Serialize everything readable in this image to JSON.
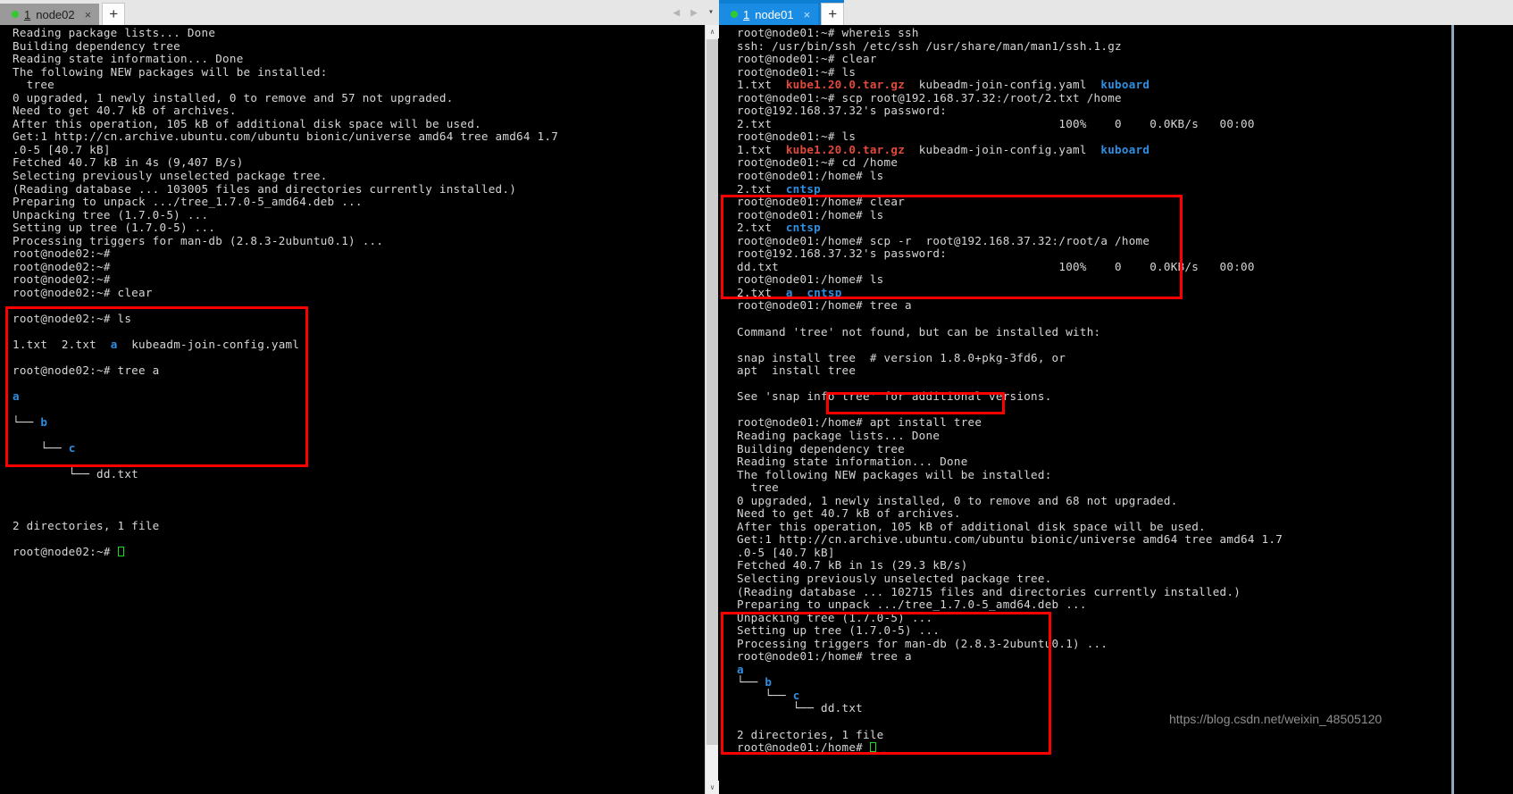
{
  "watermark": "https://blog.csdn.net/weixin_48505120",
  "left_window": {
    "tab": {
      "number": "1",
      "title": "node02",
      "close": "×",
      "status_dot": "green-dot-icon"
    },
    "new_tab_label": "+",
    "nav": {
      "back": "◀",
      "forward": "▶",
      "menu": "▾"
    },
    "terminal_lines": [
      "Reading package lists... Done",
      "Building dependency tree",
      "Reading state information... Done",
      "The following NEW packages will be installed:",
      "  tree",
      "0 upgraded, 1 newly installed, 0 to remove and 57 not upgraded.",
      "Need to get 40.7 kB of archives.",
      "After this operation, 105 kB of additional disk space will be used.",
      "Get:1 http://cn.archive.ubuntu.com/ubuntu bionic/universe amd64 tree amd64 1.7",
      ".0-5 [40.7 kB]",
      "Fetched 40.7 kB in 4s (9,407 B/s)",
      "Selecting previously unselected package tree.",
      "(Reading database ... 103005 files and directories currently installed.)",
      "Preparing to unpack .../tree_1.7.0-5_amd64.deb ...",
      "Unpacking tree (1.7.0-5) ...",
      "Setting up tree (1.7.0-5) ...",
      "Processing triggers for man-db (2.8.3-2ubuntu0.1) ...",
      "root@node02:~#",
      "root@node02:~#",
      "root@node02:~#",
      "root@node02:~# clear"
    ],
    "boxed_lines": {
      "cmd_ls": "root@node02:~# ls",
      "ls_out_1": "1.txt  2.txt  ",
      "ls_out_dir": "a",
      "ls_out_2": "  kubeadm-join-config.yaml",
      "cmd_tree": "root@node02:~# tree a",
      "tree_a": "a",
      "tree_b_branch": "└── ",
      "tree_b": "b",
      "tree_c_branch": "    └── ",
      "tree_c": "c",
      "tree_file_branch": "        └── dd.txt",
      "tree_blank": "",
      "tree_summary": "2 directories, 1 file",
      "prompt_final": "root@node02:~# "
    }
  },
  "right_window": {
    "tab": {
      "number": "1",
      "title": "node01",
      "close": "×",
      "status_dot": "green-dot-icon"
    },
    "new_tab_label": "+",
    "scroll": {
      "up": "∧",
      "down": "∨"
    },
    "segment_1": [
      "root@node01:~# whereis ssh",
      "ssh: /usr/bin/ssh /etc/ssh /usr/share/man/man1/ssh.1.gz",
      "root@node01:~# clear",
      "root@node01:~# ls"
    ],
    "ls_line_1": {
      "plain_a": "1.txt  ",
      "archive": "kube1.20.0.tar.gz",
      "plain_b": "  kubeadm-join-config.yaml  ",
      "dir": "kuboard"
    },
    "segment_2": [
      "root@node01:~# scp root@192.168.37.32:/root/2.txt /home",
      "root@192.168.37.32's password:",
      "2.txt                                         100%    0    0.0KB/s   00:00",
      "root@node01:~# ls"
    ],
    "ls_line_2": {
      "plain_a": "1.txt  ",
      "archive": "kube1.20.0.tar.gz",
      "plain_b": "  kubeadm-join-config.yaml  ",
      "dir": "kuboard"
    },
    "segment_3": [
      "root@node01:~# cd /home",
      "root@node01:/home# ls"
    ],
    "ls_line_3": {
      "plain_a": "2.txt  ",
      "dir": "cntsp"
    },
    "segment_4": [
      "root@node01:/home# clear"
    ],
    "boxed_block_1": {
      "cmd_ls": "root@node01:/home# ls",
      "ls_plain": "2.txt  ",
      "ls_dir": "cntsp",
      "cmd_scp": "root@node01:/home# scp -r  root@192.168.37.32:/root/a /home",
      "password": "root@192.168.37.32's password:",
      "transfer": "dd.txt                                        100%    0    0.0KB/s   00:00",
      "cmd_ls2": "root@node01:/home# ls",
      "ls2_plain_a": "2.txt  ",
      "ls2_dir_a": "a",
      "ls2_plain_b": "  ",
      "ls2_dir_b": "cntsp",
      "cmd_tree": "root@node01:/home# tree a"
    },
    "tree_not_found": [
      "",
      "Command 'tree' not found, but can be installed with:",
      "",
      "snap install tree  # version 1.8.0+pkg-3fd6, or",
      "apt  install tree",
      "",
      "See 'snap info tree' for additional versions.",
      ""
    ],
    "apt_prompt": {
      "prompt": "root@node01:/home# ",
      "command": "apt install tree"
    },
    "apt_output": [
      "Reading package lists... Done",
      "Building dependency tree",
      "Reading state information... Done",
      "The following NEW packages will be installed:",
      "  tree",
      "0 upgraded, 1 newly installed, 0 to remove and 68 not upgraded.",
      "Need to get 40.7 kB of archives.",
      "After this operation, 105 kB of additional disk space will be used.",
      "Get:1 http://cn.archive.ubuntu.com/ubuntu bionic/universe amd64 tree amd64 1.7",
      ".0-5 [40.7 kB]",
      "Fetched 40.7 kB in 1s (29.3 kB/s)",
      "Selecting previously unselected package tree.",
      "(Reading database ... 102715 files and directories currently installed.)",
      "Preparing to unpack .../tree_1.7.0-5_amd64.deb ...",
      "Unpacking tree (1.7.0-5) ...",
      "Setting up tree (1.7.0-5) ...",
      "Processing triggers for man-db (2.8.3-2ubuntu0.1) ..."
    ],
    "boxed_block_2": {
      "cmd_tree": "root@node01:/home# tree a",
      "tree_a": "a",
      "tree_b_branch": "└── ",
      "tree_b": "b",
      "tree_c_branch": "    └── ",
      "tree_c": "c",
      "tree_file_branch": "        └── dd.txt",
      "tree_blank": "",
      "tree_summary": "2 directories, 1 file",
      "prompt_final": "root@node01:/home# "
    }
  }
}
